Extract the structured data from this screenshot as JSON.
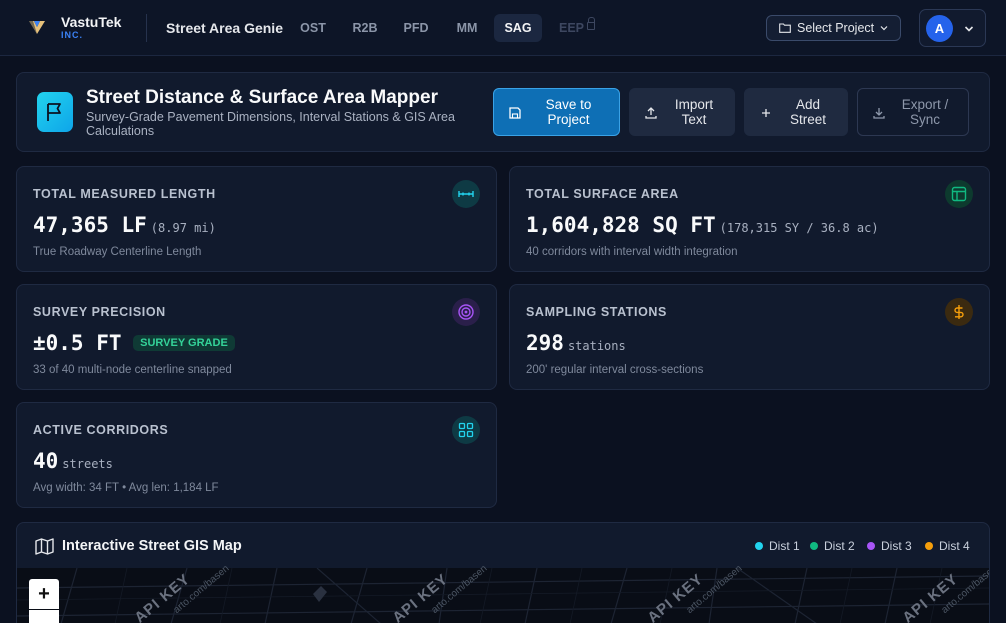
{
  "nav": {
    "brand_name": "VastuTek",
    "brand_sub": "INC.",
    "app_title": "Street Area Genie",
    "tabs": [
      {
        "label": "OST"
      },
      {
        "label": "R2B"
      },
      {
        "label": "PFD"
      },
      {
        "label": "MM"
      },
      {
        "label": "SAG",
        "active": true
      },
      {
        "label": "EEP",
        "locked": true
      }
    ],
    "select_project": "Select Project",
    "avatar_initial": "A"
  },
  "header": {
    "title": "Street Distance & Surface Area Mapper",
    "subtitle": "Survey-Grade Pavement Dimensions, Interval Stations & GIS Area Calculations",
    "buttons": {
      "save": "Save to Project",
      "import": "Import Text",
      "add": "Add Street",
      "export": "Export / Sync"
    }
  },
  "stats": {
    "length": {
      "label": "TOTAL MEASURED LENGTH",
      "value": "47,365 LF",
      "secondary": "(8.97 mi)",
      "sub": "True Roadway Centerline Length",
      "icon": "measure-icon",
      "color": "#22d3ee"
    },
    "area": {
      "label": "TOTAL SURFACE AREA",
      "value": "1,604,828 SQ FT",
      "secondary": "(178,315 SY / 36.8 ac)",
      "sub": "40 corridors with interval width integration",
      "icon": "layout-icon",
      "color": "#10b981"
    },
    "precision": {
      "label": "SURVEY PRECISION",
      "value": "±0.5 FT",
      "badge": "SURVEY GRADE",
      "sub": "33 of 40 multi-node centerline snapped",
      "icon": "target-icon",
      "color": "#a855f7"
    },
    "stations": {
      "label": "SAMPLING STATIONS",
      "value": "298",
      "secondary": "stations",
      "sub": "200' regular interval cross-sections",
      "icon": "dollar-icon",
      "color": "#f59e0b"
    },
    "corridors": {
      "label": "ACTIVE CORRIDORS",
      "value": "40",
      "secondary": "streets",
      "sub": "Avg width: 34 FT • Avg len: 1,184 LF",
      "icon": "grid-icon",
      "color": "#22d3ee"
    }
  },
  "map": {
    "title": "Interactive Street GIS Map",
    "legend": [
      {
        "label": "Dist 1",
        "color": "#22d3ee"
      },
      {
        "label": "Dist 2",
        "color": "#10b981"
      },
      {
        "label": "Dist 3",
        "color": "#a855f7"
      },
      {
        "label": "Dist 4",
        "color": "#f59e0b"
      }
    ],
    "zoom_in": "+",
    "watermark": "API KEY",
    "watermark_url": "arto.com/basen"
  }
}
